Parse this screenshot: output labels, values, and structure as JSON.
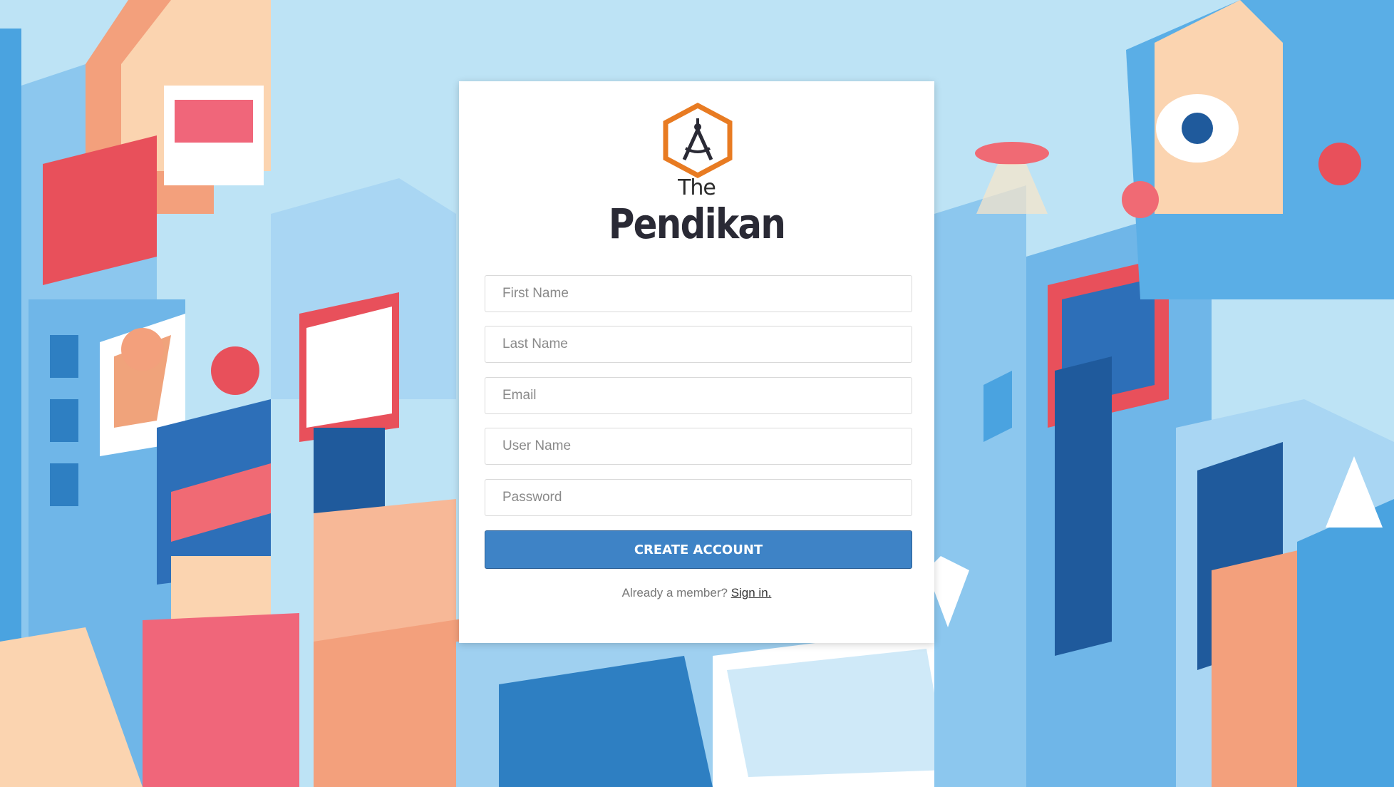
{
  "brand": {
    "the": "The",
    "name": "Pendikan"
  },
  "form": {
    "first_name_placeholder": "First Name",
    "last_name_placeholder": "Last Name",
    "email_placeholder": "Email",
    "username_placeholder": "User Name",
    "password_placeholder": "Password",
    "submit_label": "CREATE ACCOUNT"
  },
  "footer": {
    "prompt": "Already a member?",
    "signin_label": "Sign in."
  },
  "colors": {
    "accent": "#3e83c6",
    "logo_orange": "#e87b22",
    "text_dark": "#2a2a35"
  },
  "icons": {
    "logo": "compass-hexagon-icon"
  }
}
